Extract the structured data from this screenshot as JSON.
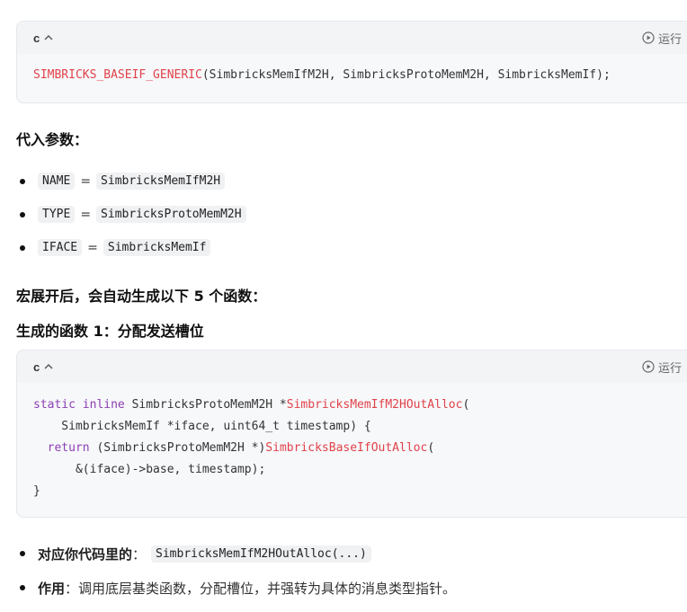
{
  "block1": {
    "lang": "c",
    "run_label": "运行",
    "code_fn": "SIMBRICKS_BASEIF_GENERIC",
    "code_args": "(SimbricksMemIfM2H, SimbricksProtoMemM2H, SimbricksMemIf);"
  },
  "heading_params": "代入参数：",
  "params": [
    {
      "name": "NAME",
      "eq": "=",
      "value": "SimbricksMemIfM2H"
    },
    {
      "name": "TYPE",
      "eq": "=",
      "value": "SimbricksProtoMemM2H"
    },
    {
      "name": "IFACE",
      "eq": "=",
      "value": "SimbricksMemIf"
    }
  ],
  "heading_expand": "宏展开后，会自动生成以下 5 个函数：",
  "heading_func1": "生成的函数 1：分配发送槽位",
  "block2": {
    "lang": "c",
    "run_label": "运行",
    "l1_kw": "static inline",
    "l1_type": " SimbricksProtoMemM2H *",
    "l1_fn": "SimbricksMemIfM2HOutAlloc",
    "l1_tail": "(",
    "l2": "    SimbricksMemIf *iface, uint64_t timestamp) {",
    "l3_indent": "  ",
    "l3_kw": "return",
    "l3_mid": " (SimbricksProtoMemM2H *)",
    "l3_fn": "SimbricksBaseIfOutAlloc",
    "l3_tail": "(",
    "l4": "      &(iface)->base, timestamp);",
    "l5": "}"
  },
  "notes": [
    {
      "label": "对应你代码里的",
      "sep": "：",
      "code": "SimbricksMemIfM2HOutAlloc(...)"
    },
    {
      "label": "作用",
      "sep": "：",
      "text": "调用底层基类函数，分配槽位，并强转为具体的消息类型指针。"
    }
  ]
}
